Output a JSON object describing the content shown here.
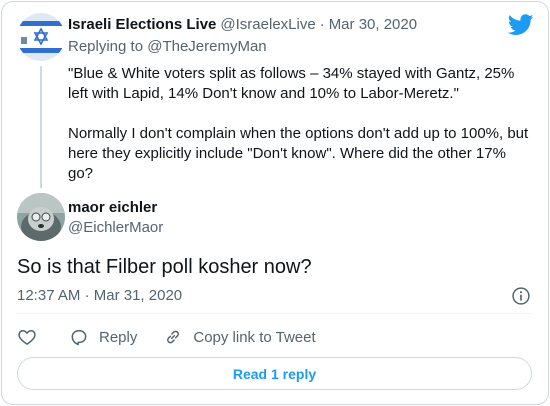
{
  "parent_tweet": {
    "author_name": "Israeli Elections Live",
    "author_handle": "@IsraelexLive",
    "date": "Mar 30, 2020",
    "replying_prefix": "Replying to",
    "replying_to": "@TheJeremyMan",
    "paragraphs": [
      "\"Blue & White voters split as follows – 34% stayed with Gantz, 25% left with Lapid, 14% Don't know and 10% to Labor-Meretz.\"",
      "Normally I don't complain when the options don't add up to 100%, but here they explicitly include \"Don't know\". Where did the other 17% go?"
    ]
  },
  "reply_tweet": {
    "author_name": "maor eichler",
    "author_handle": "@EichlerMaor",
    "text": "So is that Filber poll kosher now?",
    "time": "12:37 AM",
    "date": "Mar 31, 2020"
  },
  "actions": {
    "reply_label": "Reply",
    "copy_link_label": "Copy link to Tweet"
  },
  "read_replies_label": "Read 1 reply",
  "colors": {
    "brand_blue": "#1d9bf0",
    "secondary_text": "#536471",
    "primary_text": "#0f1419",
    "border": "#cfd9de"
  },
  "icons": [
    "twitter-logo-icon",
    "info-icon",
    "heart-icon",
    "reply-bubble-icon",
    "link-icon"
  ]
}
